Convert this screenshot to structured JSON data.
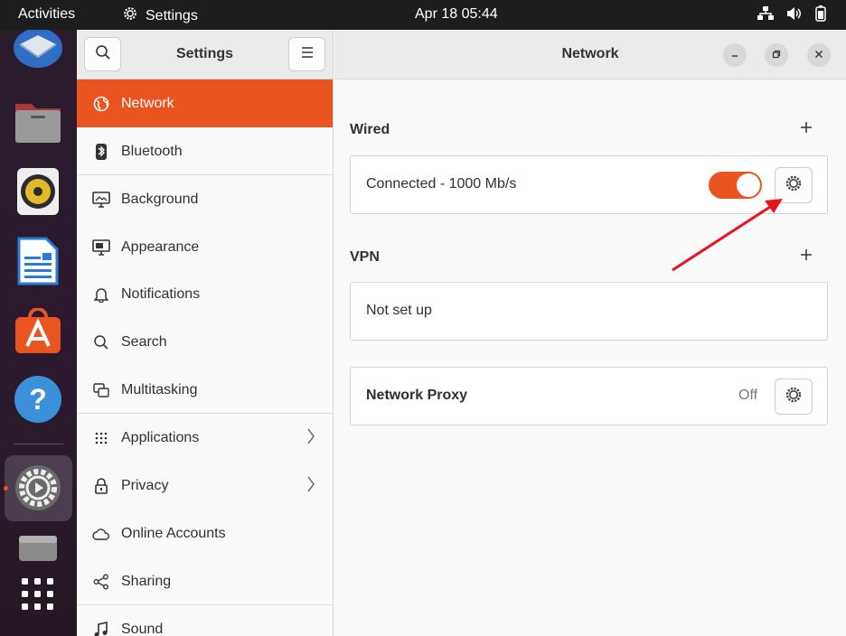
{
  "topbar": {
    "activities": "Activities",
    "app_name": "Settings",
    "clock": "Apr 18  05:44"
  },
  "dock": {
    "items": [
      {
        "name": "thunderbird",
        "color": "#2f6ec5"
      },
      {
        "name": "files",
        "color": "#8a8a8a"
      },
      {
        "name": "rhythmbox",
        "color": "#e0c04a"
      },
      {
        "name": "libreoffice-writer",
        "color": "#2a7bd3"
      },
      {
        "name": "app-center",
        "color": "#e95420"
      },
      {
        "name": "help",
        "color": "#3c8fd9"
      },
      {
        "name": "settings",
        "color": "#888"
      },
      {
        "name": "drive",
        "color": "#777"
      },
      {
        "name": "show-apps",
        "color": "#ffffff"
      }
    ]
  },
  "sidebar": {
    "title": "Settings",
    "items": [
      {
        "label": "Network",
        "icon": "network-icon",
        "active": true
      },
      {
        "label": "Bluetooth",
        "icon": "bluetooth-icon"
      },
      {
        "label": "Background",
        "icon": "background-icon"
      },
      {
        "label": "Appearance",
        "icon": "appearance-icon"
      },
      {
        "label": "Notifications",
        "icon": "bell-icon"
      },
      {
        "label": "Search",
        "icon": "search-icon"
      },
      {
        "label": "Multitasking",
        "icon": "multitasking-icon"
      },
      {
        "label": "Applications",
        "icon": "grid-icon",
        "chevron": true
      },
      {
        "label": "Privacy",
        "icon": "lock-icon",
        "chevron": true
      },
      {
        "label": "Online Accounts",
        "icon": "cloud-icon"
      },
      {
        "label": "Sharing",
        "icon": "share-icon"
      },
      {
        "label": "Sound",
        "icon": "music-icon"
      }
    ]
  },
  "main": {
    "title": "Network",
    "wired": {
      "title": "Wired",
      "status": "Connected - 1000 Mb/s",
      "enabled": true
    },
    "vpn": {
      "title": "VPN",
      "status": "Not set up"
    },
    "proxy": {
      "title": "Network Proxy",
      "status": "Off"
    }
  },
  "colors": {
    "accent": "#e95420",
    "annotation_arrow": "#e8141b"
  }
}
